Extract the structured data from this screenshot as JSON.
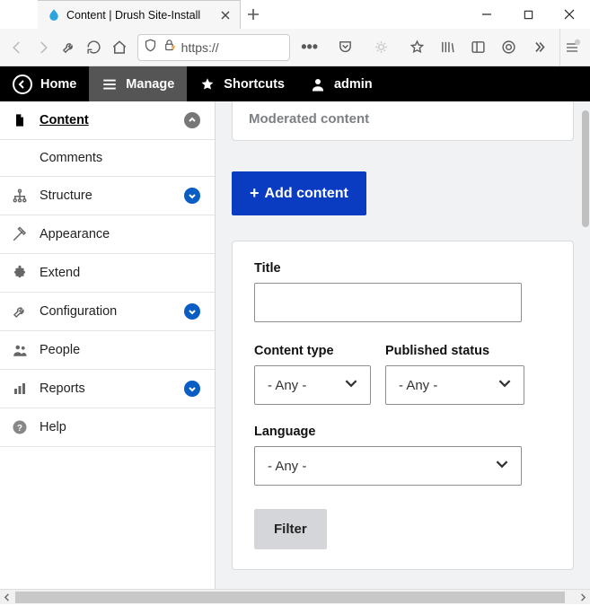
{
  "window": {
    "tab_title": "Content | Drush Site-Install"
  },
  "urlbar": {
    "text": "https://"
  },
  "admin_bar": {
    "home": "Home",
    "manage": "Manage",
    "shortcuts": "Shortcuts",
    "admin": "admin"
  },
  "side_menu": {
    "content": "Content",
    "comments": "Comments",
    "structure": "Structure",
    "appearance": "Appearance",
    "extend": "Extend",
    "configuration": "Configuration",
    "people": "People",
    "reports": "Reports",
    "help": "Help"
  },
  "main": {
    "moderated_tab": "Moderated content",
    "add_content": "Add content",
    "filters": {
      "title_label": "Title",
      "title_value": "",
      "ctype_label": "Content type",
      "ctype_value": "- Any -",
      "pub_label": "Published status",
      "pub_value": "- Any -",
      "lang_label": "Language",
      "lang_value": "- Any -",
      "filter_btn": "Filter"
    }
  }
}
